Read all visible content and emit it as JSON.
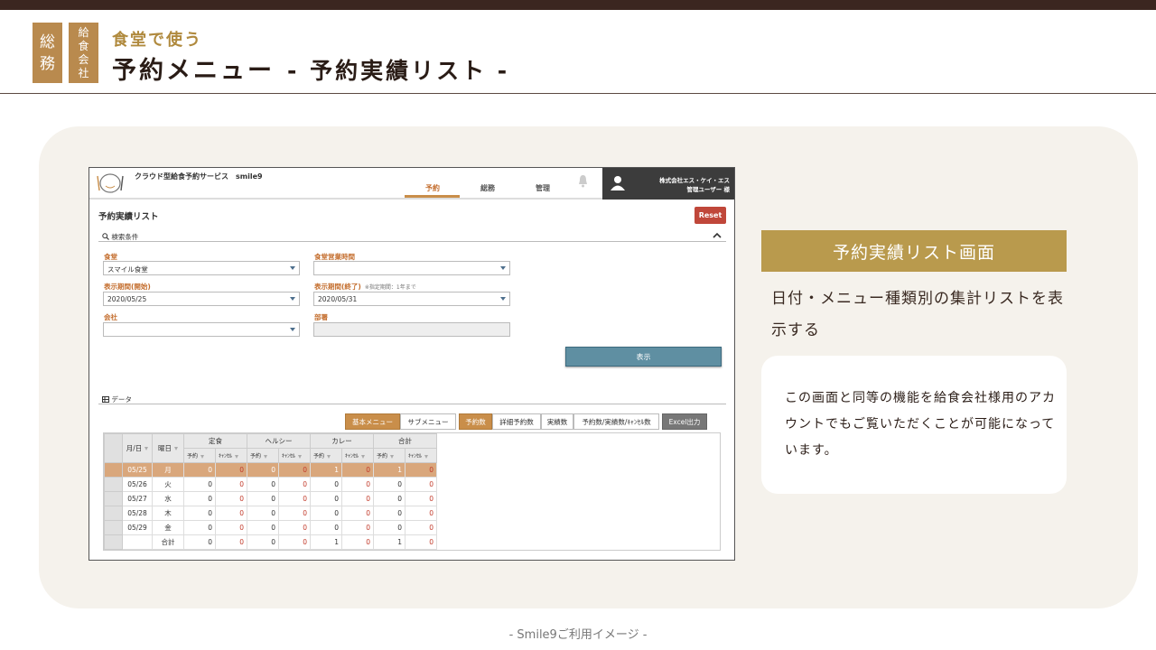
{
  "slide": {
    "badge1": [
      "総",
      "務"
    ],
    "badge2": [
      "給",
      "食",
      "会",
      "社"
    ],
    "subtitle": "食堂で使う",
    "title": "予約メニュー",
    "title_sub": "- 予約実績リスト -",
    "caption": "- Smile9ご利用イメージ -",
    "right_heading": "予約実績リスト画面",
    "right_desc": "日付・メニュー種類別の集計リストを表示する",
    "right_note": "この画面と同等の機能を給食会社様用のアカウントでもご覧いただくことが可能になっています。"
  },
  "app": {
    "brand": "クラウド型給食予約サービス　smile9",
    "nav": [
      "予約",
      "総務",
      "管理"
    ],
    "company": "株式会社エス・ケイ・エス",
    "user": "管理ユーザー 様",
    "page_title": "予約実績リスト",
    "reset_label": "Reset",
    "search_section": "検索条件",
    "data_section": "データ",
    "fields": {
      "shokudo_label": "食堂",
      "shokudo_value": "スマイル食堂",
      "eigyo_label": "食堂営業時間",
      "eigyo_value": "",
      "start_label": "表示期間(開始)",
      "start_value": "2020/05/25",
      "end_label": "表示期間(終了)",
      "end_note": "※指定期間：1年まで",
      "end_value": "2020/05/31",
      "company_label": "会社",
      "company_value": "",
      "dept_label": "部署",
      "dept_value": ""
    },
    "show_label": "表示",
    "tabs": [
      "基本メニュー",
      "サブメニュー"
    ],
    "metric_tabs": [
      "予約数",
      "詳細予約数",
      "実績数",
      "予約数/実績数/ｷｬﾝｾﾙ数"
    ],
    "excel_label": "Excel出力",
    "table": {
      "col_date": "月/日",
      "col_dow": "曜日",
      "groups": [
        "定食",
        "ヘルシー",
        "カレー",
        "合計"
      ],
      "sub_reserve": "予約",
      "sub_cancel": "ｷｬﾝｾﾙ",
      "rows": [
        {
          "date": "05/25",
          "dow": "月",
          "v": [
            0,
            0,
            0,
            0,
            1,
            0,
            1,
            0
          ]
        },
        {
          "date": "05/26",
          "dow": "火",
          "v": [
            0,
            0,
            0,
            0,
            0,
            0,
            0,
            0
          ]
        },
        {
          "date": "05/27",
          "dow": "水",
          "v": [
            0,
            0,
            0,
            0,
            0,
            0,
            0,
            0
          ]
        },
        {
          "date": "05/28",
          "dow": "木",
          "v": [
            0,
            0,
            0,
            0,
            0,
            0,
            0,
            0
          ]
        },
        {
          "date": "05/29",
          "dow": "金",
          "v": [
            0,
            0,
            0,
            0,
            0,
            0,
            0,
            0
          ]
        },
        {
          "date": "",
          "dow": "合計",
          "v": [
            0,
            0,
            0,
            0,
            1,
            0,
            1,
            0
          ]
        }
      ]
    }
  },
  "colors": {
    "accent": "#b98a4e",
    "header": "#3b2620",
    "reset": "#c0473a",
    "show": "#5f8fa2"
  }
}
